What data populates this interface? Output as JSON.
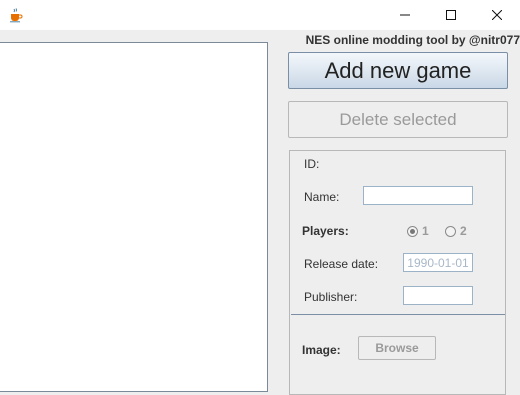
{
  "window": {
    "minimize_icon": "minimize-icon",
    "maximize_icon": "maximize-icon",
    "close_icon": "close-icon",
    "app_icon": "java-coffee-cup-icon"
  },
  "author": "NES online modding tool by @nitr077",
  "games_list": {
    "items": []
  },
  "buttons": {
    "add_new_game": "Add new game",
    "delete_selected": "Delete selected",
    "browse": "Browse"
  },
  "form": {
    "id_label": "ID:",
    "id_value": "",
    "name_label": "Name:",
    "name_value": "",
    "players_label": "Players:",
    "players_options": [
      "1",
      "2"
    ],
    "players_selected": "1",
    "release_date_label": "Release date:",
    "release_date_value": "1990-01-01",
    "publisher_label": "Publisher:",
    "publisher_value": "",
    "image_label": "Image:"
  },
  "colors": {
    "accent_border": "#7a8fa6",
    "disabled_text": "#9a9a9a",
    "window_bg": "#eeeeee"
  }
}
